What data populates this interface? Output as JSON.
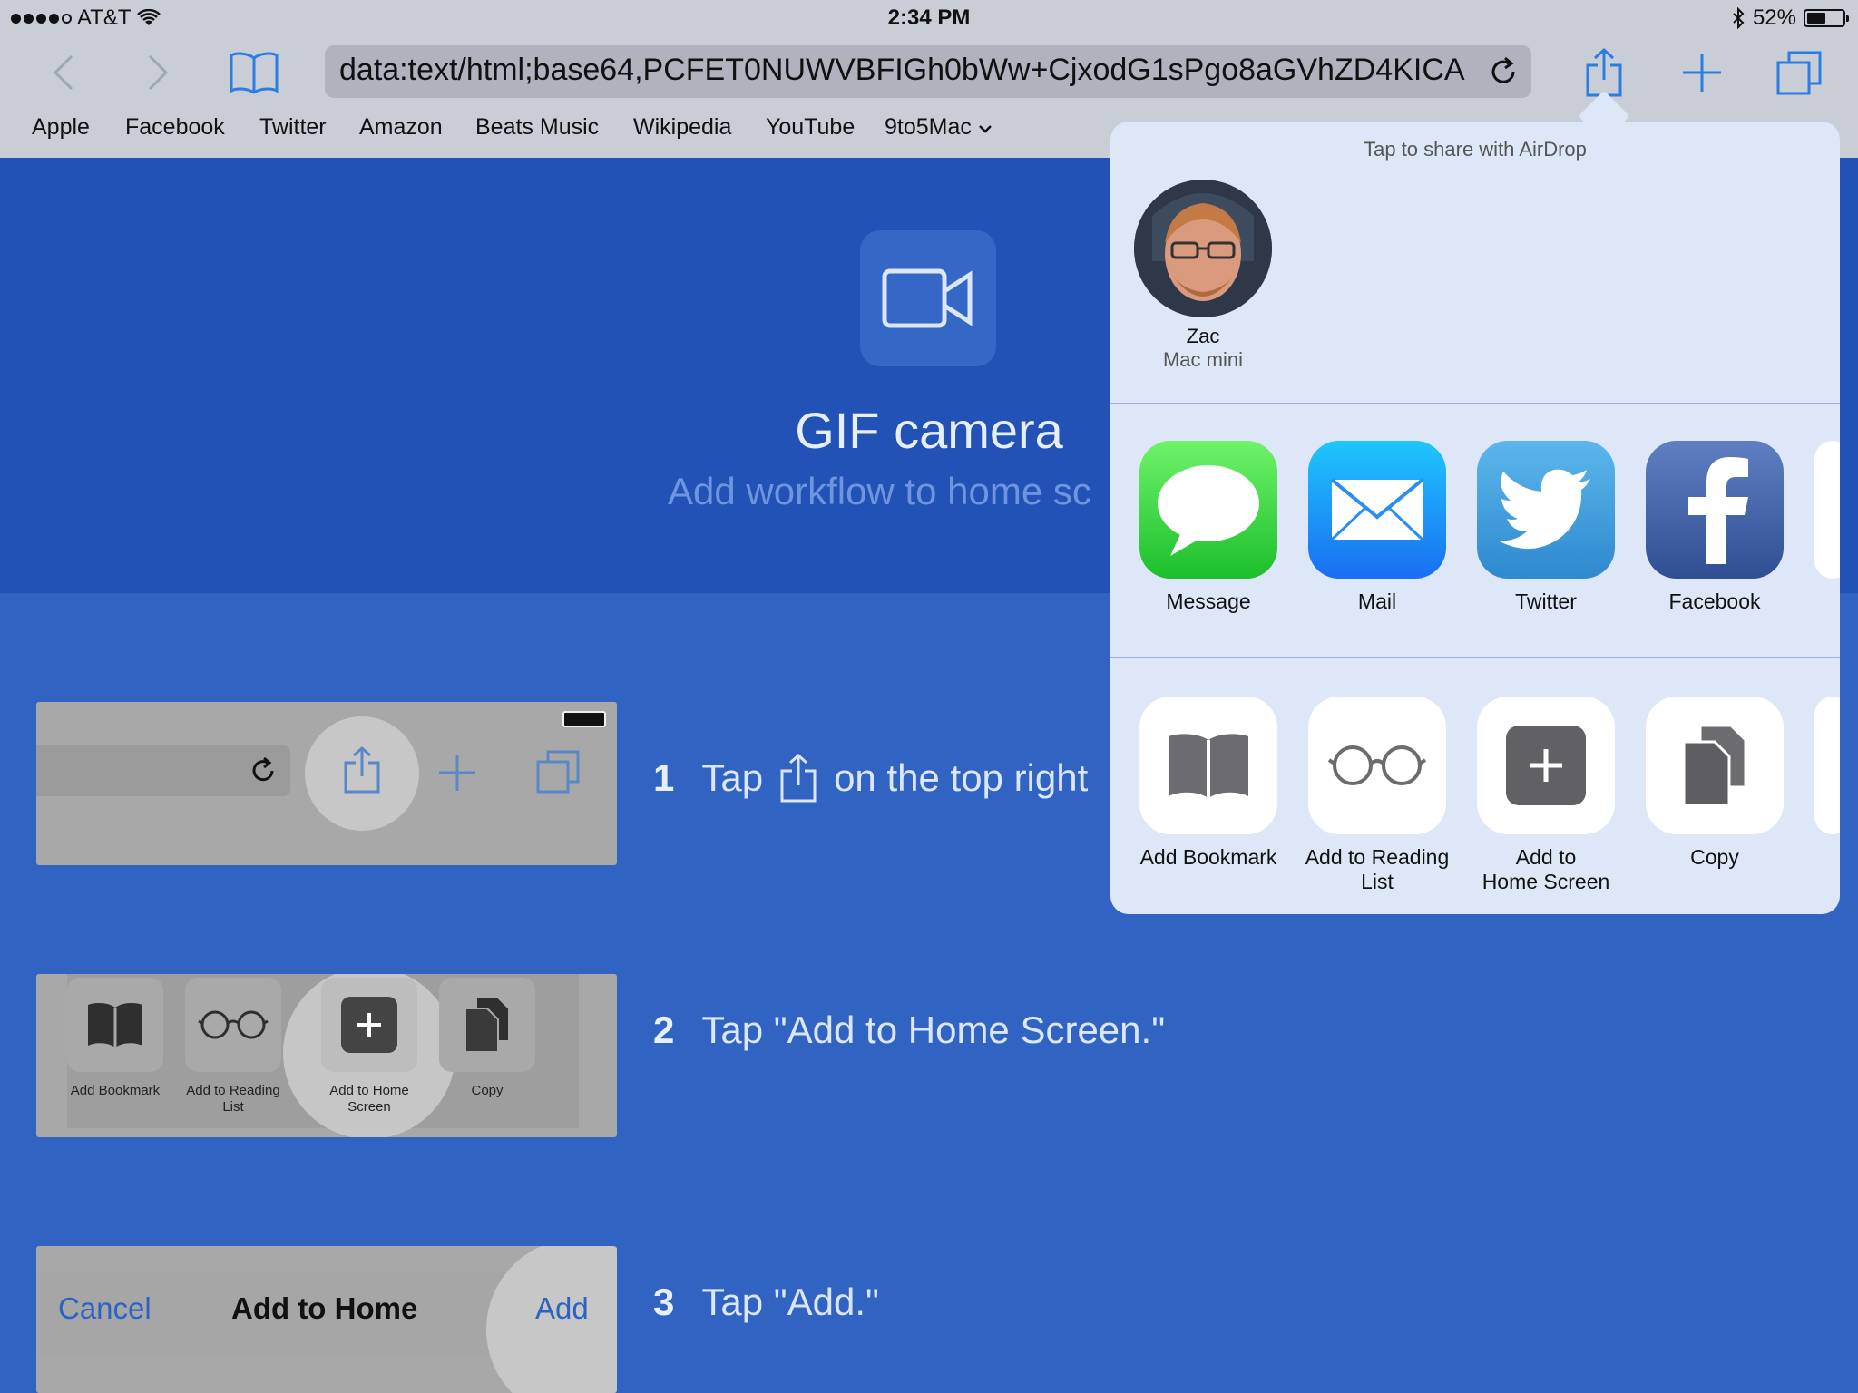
{
  "status": {
    "carrier": "AT&T",
    "time": "2:34 PM",
    "battery": "52%",
    "battery_level": 0.52
  },
  "browser": {
    "url": "data:text/html;base64,PCFET0NUWVBFIGh0bWw+CjxodG1sPgo8aGVhZD4KICA",
    "bookmarks": [
      "Apple",
      "Facebook",
      "Twitter",
      "Amazon",
      "Beats Music",
      "Wikipedia",
      "YouTube",
      "9to5Mac"
    ]
  },
  "page": {
    "title": "GIF camera",
    "subtitle": "Add workflow to home sc",
    "steps": [
      {
        "num": "1",
        "pre": "Tap",
        "post": "on the top right"
      },
      {
        "num": "2",
        "text": "Tap \"Add to Home Screen.\""
      },
      {
        "num": "3",
        "text": "Tap \"Add.\""
      }
    ],
    "step2_labels": [
      "Add Bookmark",
      "Add to Reading List",
      "Add to Home Screen",
      "Copy"
    ],
    "step3": {
      "cancel": "Cancel",
      "title": "Add to Home",
      "add": "Add"
    }
  },
  "share": {
    "airdrop_title": "Tap to share with AirDrop",
    "person": {
      "name": "Zac",
      "device": "Mac mini"
    },
    "apps": [
      "Message",
      "Mail",
      "Twitter",
      "Facebook"
    ],
    "actions": [
      {
        "line1": "Add Bookmark",
        "line2": ""
      },
      {
        "line1": "Add to Reading",
        "line2": "List"
      },
      {
        "line1": "Add to",
        "line2": "Home Screen"
      },
      {
        "line1": "Copy",
        "line2": ""
      }
    ]
  },
  "colors": {
    "accent": "#2a7de1",
    "hero_bg": "#2252b5",
    "page_bg": "#3063c2",
    "popover_bg": "#dde7f8"
  }
}
